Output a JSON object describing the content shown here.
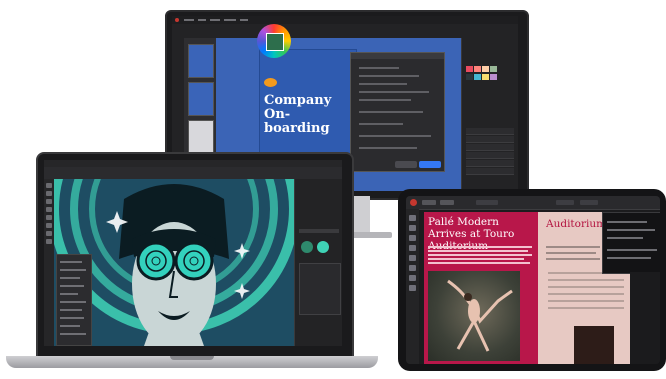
{
  "monitor": {
    "document_title": "Company On-boarding",
    "swatch_colors": [
      "#e84a5f",
      "#ff847c",
      "#fecea8",
      "#99b898",
      "#2a363b",
      "#45b7d1",
      "#f7dc6f",
      "#bb8fce"
    ]
  },
  "laptop": {
    "canvas_colors": {
      "background": "#1e4d63",
      "accent": "#3fd3b6"
    }
  },
  "tablet": {
    "left_page_heading": "Pallé Modern Arrives at Touro Auditorium",
    "right_page_heading": "Auditorium Seating Placement",
    "accent_color": "#b8174a"
  }
}
